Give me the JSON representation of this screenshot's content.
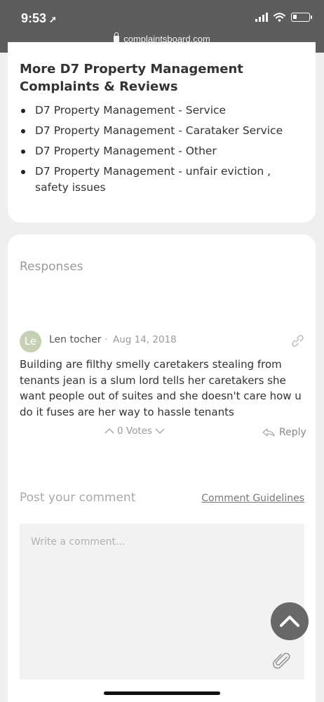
{
  "status_bar": {
    "time": "9:53",
    "time_arrow": "➚",
    "url": "complaintsboard.com"
  },
  "more_section": {
    "title": "More D7 Property Management Complaints & Reviews",
    "items": [
      "D7 Property Management - Service",
      "D7 Property Management - Carataker Service",
      "D7 Property Management - Other",
      "D7 Property Management - unfair eviction , safety issues"
    ]
  },
  "responses": {
    "heading": "Responses",
    "comment": {
      "avatar_initials": "Le",
      "author": "Len tocher",
      "separator": "·",
      "date": "Aug 14, 2018",
      "text": "Building are filthy smelly caretakers stealing from tenants jean is a slum lord tells her caretakers she want people out of suites and she doesn't care how u do it fuses are her way to hassle tenants",
      "votes": "0 Votes",
      "reply_label": "Reply"
    }
  },
  "post_comment": {
    "label": "Post your comment",
    "guidelines_link": "Comment Guidelines",
    "placeholder": "Write a comment..."
  },
  "colors": {
    "status_bar_bg": "#5d5d5d",
    "avatar_bg": "#c6d0b2",
    "scroll_top_bg": "#686868"
  },
  "icons": [
    "location-arrow-icon",
    "lock-icon",
    "signal-icon",
    "wifi-icon",
    "battery-icon",
    "link-icon",
    "chevron-up-icon",
    "chevron-down-icon",
    "reply-arrow-icon",
    "paperclip-icon",
    "scroll-top-icon"
  ]
}
